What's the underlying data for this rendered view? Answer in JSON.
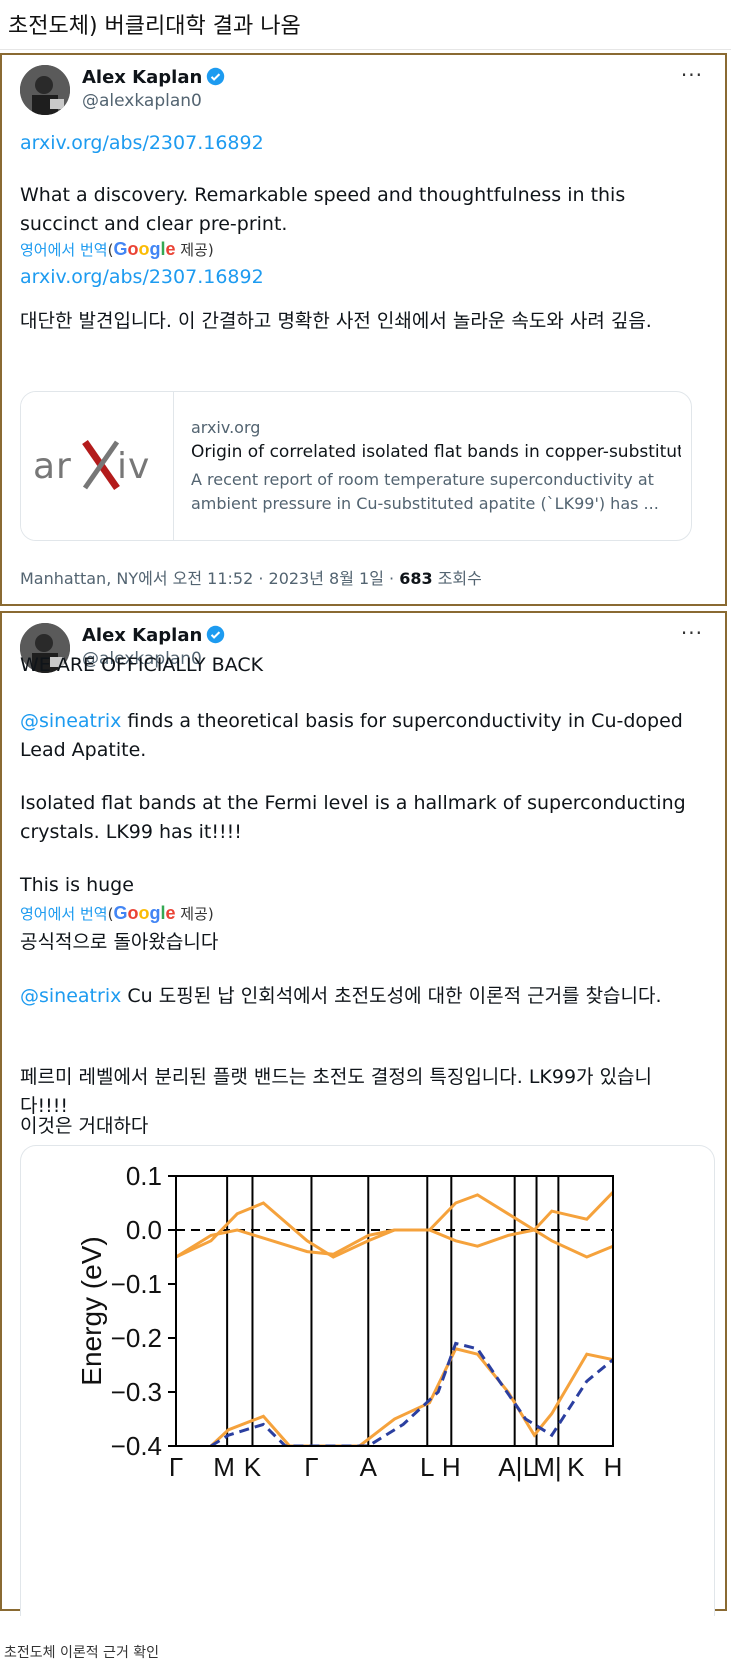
{
  "post": {
    "title": "초전도체) 버클리대학 결과 나옴",
    "caption": "초전도체 이론적 근거 확인"
  },
  "colors": {
    "accent": "#1d9bf0",
    "border": "#8a6a32",
    "orange": "#f5a23c",
    "blue": "#2b3fa0"
  },
  "tweet1": {
    "author": {
      "name": "Alex Kaplan",
      "handle": "@alexkaplan0",
      "verified_icon": "verified-badge-icon"
    },
    "more": "···",
    "link1": "arxiv.org/abs/2307.16892",
    "text_en": "What a discovery. Remarkable speed and thoughtfulness in this succinct and clear pre-print.",
    "translate": {
      "prefix": "영어에서 번역",
      "open": "(",
      "google": "Google",
      "suffix": " 제공)"
    },
    "link2": "arxiv.org/abs/2307.16892",
    "text_ko": "대단한 발견입니다. 이 간결하고 명확한 사전 인쇄에서 놀라운 속도와 사려 깊음.",
    "card": {
      "logo_text": "arXiv",
      "domain": "arxiv.org",
      "title": "Origin of correlated isolated flat bands in copper-substitut...",
      "description": "A recent report of room temperature superconductivity at ambient pressure in Cu-substituted apatite (`LK99') has ..."
    },
    "meta": {
      "location_time": "Manhattan, NY에서 오전 11:52 · 2023년 8월 1일 · ",
      "views": "683",
      "views_label": " 조회수"
    }
  },
  "tweet2": {
    "author": {
      "name": "Alex Kaplan",
      "handle": "@alexkaplan0"
    },
    "more": "···",
    "p1": "WE ARE OFFICIALLY BACK",
    "p2_mention": "@sineatrix",
    "p2_rest": " finds a theoretical basis for superconductivity in Cu-doped Lead Apatite.",
    "p3": "Isolated flat bands at the Fermi level is a hallmark of superconducting crystals. LK99 has it!!!!",
    "p4": "This is huge",
    "translate": {
      "prefix": "영어에서 번역",
      "open": "(",
      "google": "Google",
      "suffix": " 제공)"
    },
    "k1": "공식적으로 돌아왔습니다",
    "k2_mention": "@sineatrix",
    "k2_rest": " Cu 도핑된 납 인회석에서 초전도성에 대한 이론적 근거를 찾습니다.",
    "k3": "페르미 레벨에서 분리된 플랫 밴드는 초전도 결정의 특징입니다. LK99가 있습니다!!!!",
    "k4": "이것은 거대하다"
  },
  "chart_data": {
    "type": "line",
    "ylabel": "Energy (eV)",
    "ylim": [
      -0.4,
      0.1
    ],
    "yticks": [
      "0.1",
      "0.0",
      "−0.1",
      "−0.2",
      "−0.3",
      "−0.4"
    ],
    "xlabels": [
      "Γ",
      "M",
      "K",
      "Γ",
      "A",
      "L",
      "H",
      "A|",
      "L",
      "M|",
      "K",
      "H"
    ],
    "fermi_level": 0.0,
    "series": [
      {
        "style": "orange-solid",
        "points": [
          [
            0,
            -0.05
          ],
          [
            0.08,
            -0.02
          ],
          [
            0.14,
            0.03
          ],
          [
            0.2,
            0.05
          ],
          [
            0.3,
            -0.02
          ],
          [
            0.36,
            -0.05
          ],
          [
            0.44,
            -0.02
          ],
          [
            0.5,
            0.0
          ],
          [
            0.58,
            0.0
          ],
          [
            0.64,
            0.05
          ],
          [
            0.69,
            0.065
          ],
          [
            0.76,
            0.03
          ],
          [
            0.82,
            0.0
          ],
          [
            0.86,
            0.035
          ],
          [
            0.94,
            0.02
          ],
          [
            1.0,
            0.07
          ]
        ]
      },
      {
        "style": "orange-solid",
        "points": [
          [
            0,
            -0.05
          ],
          [
            0.08,
            -0.01
          ],
          [
            0.14,
            0.0
          ],
          [
            0.2,
            -0.015
          ],
          [
            0.3,
            -0.04
          ],
          [
            0.36,
            -0.045
          ],
          [
            0.44,
            -0.01
          ],
          [
            0.5,
            0.0
          ],
          [
            0.58,
            0.0
          ],
          [
            0.64,
            -0.02
          ],
          [
            0.69,
            -0.03
          ],
          [
            0.76,
            -0.01
          ],
          [
            0.82,
            0.0
          ],
          [
            0.86,
            -0.02
          ],
          [
            0.94,
            -0.05
          ],
          [
            1.0,
            -0.03
          ]
        ]
      },
      {
        "style": "orange-solid",
        "points": [
          [
            0.08,
            -0.4
          ],
          [
            0.12,
            -0.37
          ],
          [
            0.2,
            -0.345
          ],
          [
            0.26,
            -0.4
          ],
          [
            0.42,
            -0.4
          ],
          [
            0.5,
            -0.35
          ],
          [
            0.58,
            -0.32
          ],
          [
            0.64,
            -0.22
          ],
          [
            0.69,
            -0.23
          ],
          [
            0.76,
            -0.3
          ],
          [
            0.82,
            -0.38
          ],
          [
            0.86,
            -0.34
          ],
          [
            0.94,
            -0.23
          ],
          [
            1.0,
            -0.24
          ]
        ]
      },
      {
        "style": "blue-dashed",
        "points": [
          [
            0.08,
            -0.4
          ],
          [
            0.12,
            -0.38
          ],
          [
            0.2,
            -0.36
          ],
          [
            0.25,
            -0.4
          ],
          [
            0.44,
            -0.4
          ],
          [
            0.52,
            -0.36
          ],
          [
            0.6,
            -0.3
          ],
          [
            0.64,
            -0.21
          ],
          [
            0.69,
            -0.22
          ],
          [
            0.74,
            -0.28
          ],
          [
            0.8,
            -0.35
          ],
          [
            0.86,
            -0.38
          ],
          [
            0.94,
            -0.28
          ],
          [
            1.0,
            -0.24
          ]
        ]
      }
    ]
  }
}
